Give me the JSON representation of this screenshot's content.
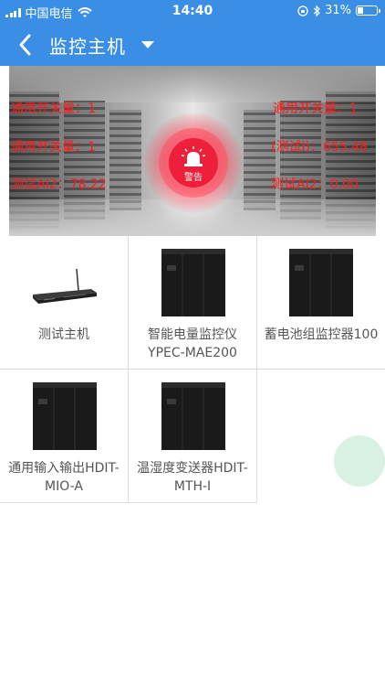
{
  "status_bar": {
    "carrier": "中国电信",
    "time": "14:40",
    "battery": "31%",
    "battery_level": 0.31
  },
  "nav": {
    "title": "监控主机",
    "back_icon": "chevron-left-icon",
    "dropdown_icon": "caret-down-icon"
  },
  "banner": {
    "left": [
      {
        "label": "通用开关量：1"
      },
      {
        "label": "通用开关量：1"
      },
      {
        "label": "测试AI2：78.22"
      }
    ],
    "right": [
      {
        "label": "通用开关量：1"
      },
      {
        "label": "(测试I)：655.48"
      },
      {
        "label": "测试AI2：0.00"
      }
    ],
    "alarm": {
      "label": "警告",
      "icon": "siren-icon",
      "color": "#ee1f3a"
    }
  },
  "devices": [
    {
      "line1": "测试主机",
      "line2": "",
      "icon": "host-device-icon"
    },
    {
      "line1": "智能电量监控仪",
      "line2": "YPEC-MAE200",
      "icon": "cabinet-icon"
    },
    {
      "line1": "蓄电池组监控器100",
      "line2": "",
      "icon": "cabinet-icon"
    },
    {
      "line1": "通用输入输出HDIT-",
      "line2": "MIO-A",
      "icon": "cabinet-icon"
    },
    {
      "line1": "温湿度变送器HDIT-",
      "line2": "MTH-I",
      "icon": "cabinet-icon"
    }
  ],
  "theme": {
    "primary": "#3a8ee6",
    "alarm_text": "#ff1a1a"
  }
}
